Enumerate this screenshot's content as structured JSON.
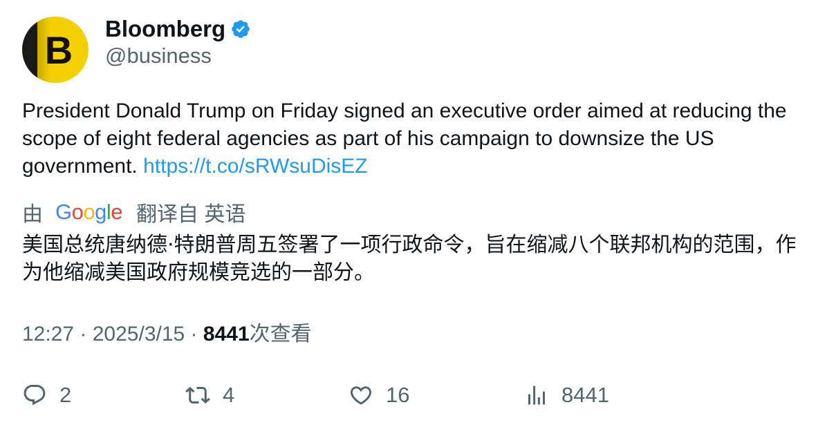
{
  "author": {
    "avatar_letter": "B",
    "name": "Bloomberg",
    "handle": "@business",
    "verified_icon": "verified-badge-icon",
    "brand_color": "#f5d000"
  },
  "tweet": {
    "text": "President Donald Trump on Friday signed an executive order aimed at reducing the scope of eight federal agencies as part of his campaign to downsize the US government. ",
    "link": "https://t.co/sRWsuDisEZ",
    "link_color": "#1d9bf0"
  },
  "translation": {
    "prefix": "由",
    "provider": "Google",
    "suffix": "翻译自 英语",
    "text": "美国总统唐纳德·特朗普周五签署了一项行政命令，旨在缩减八个联邦机构的范围，作为他缩减美国政府规模竞选的一部分。"
  },
  "meta": {
    "time": "12:27",
    "date": "2025/3/15",
    "separator": " · ",
    "views": "8441",
    "views_label": "次查看"
  },
  "actions": {
    "reply": {
      "icon": "reply-icon",
      "count": "2"
    },
    "retweet": {
      "icon": "retweet-icon",
      "count": "4"
    },
    "like": {
      "icon": "heart-icon",
      "count": "16"
    },
    "views": {
      "icon": "analytics-icon",
      "count": "8441"
    }
  }
}
